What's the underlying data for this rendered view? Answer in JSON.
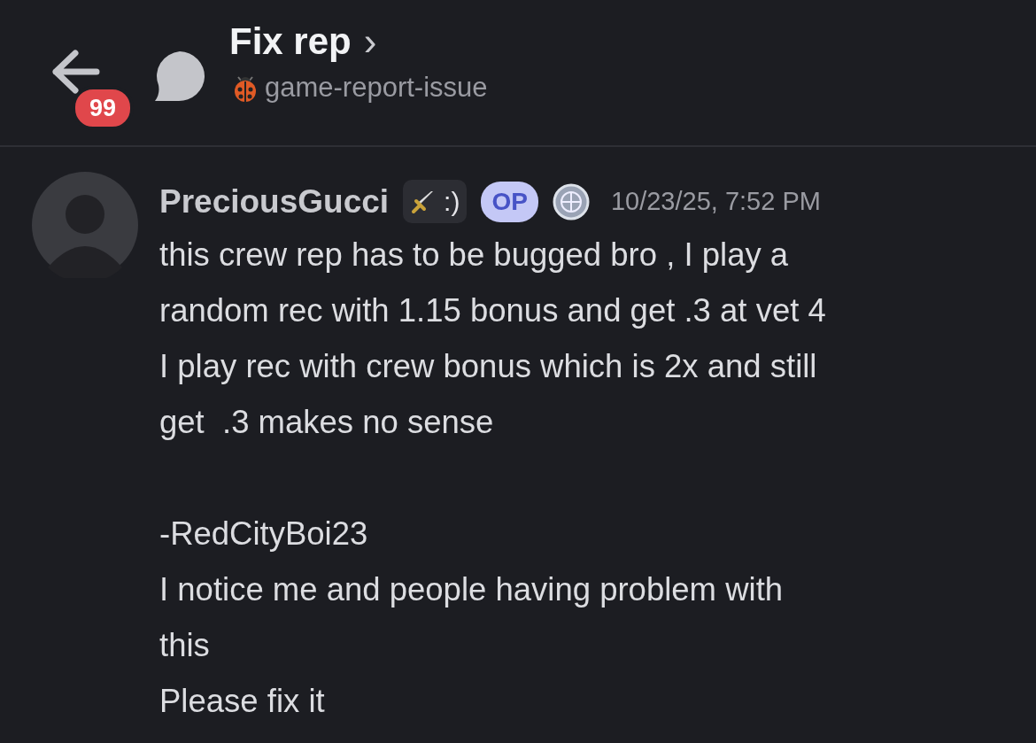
{
  "header": {
    "unread_count": "99",
    "title": "Fix rep",
    "chevron": "›",
    "channel": "game-report-issue"
  },
  "message": {
    "author": "PreciousGucci",
    "tag": ":)",
    "op_badge": "OP",
    "timestamp": "10/23/25, 7:52 PM",
    "paragraphs": [
      "this crew rep has to be bugged bro , I play a\nrandom rec with 1.15 bonus and get .3 at vet 4\nI play rec with crew bonus which is 2x and still\nget  .3 makes no sense",
      "-RedCityBoi23\nI notice me and people having problem with\nthis\nPlease fix it"
    ]
  }
}
